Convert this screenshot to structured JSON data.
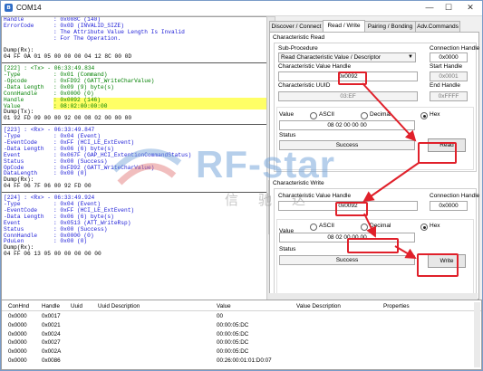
{
  "window": {
    "title": "COM14",
    "icon": "bluetooth-icon",
    "minimize": "—",
    "maximize": "☐",
    "close": "✕"
  },
  "log": {
    "header": [
      {
        "k": "Handle",
        "v": ": 0x008C (140)",
        "c": "c-blue"
      },
      {
        "k": "ErrorCode",
        "v": ": 0x0D (INVALID_SIZE)",
        "c": "c-blue"
      },
      {
        "k": "",
        "v": ": The Attribute Value Length Is Invalid",
        "c": "c-blue"
      },
      {
        "k": "",
        "v": ": For The Operation.",
        "c": "c-blue"
      }
    ],
    "dump0_label": "Dump(Rx):",
    "dump0": "04 FF 0A 01 05 00 00 00 04 12 8C 00 0D",
    "e222": {
      "header": "[222] : <Tx> - 06:33:49.834",
      "fields": [
        {
          "k": "-Type",
          "v": ": 0x01 (Command)"
        },
        {
          "k": "-Opcode",
          "v": ": 0xFD92 (GATT_WriteCharValue)"
        },
        {
          "k": "-Data Length",
          "v": ": 0x09 (9) byte(s)"
        },
        {
          "k": "ConnHandle",
          "v": ": 0x0000 (0)"
        },
        {
          "k": "Handle",
          "v": ": 0x0092 (146)"
        },
        {
          "k": "Value",
          "v": ": 08:02:00:00:00"
        }
      ],
      "dump_label": "Dump(Tx):",
      "dump": "01 92 FD 09 00 00 92 00 08 02 00 00 00"
    },
    "e223": {
      "header": "[223] : <Rx> - 06:33:49.847",
      "fields": [
        {
          "k": "-Type",
          "v": ": 0x04 (Event)"
        },
        {
          "k": "-EventCode",
          "v": ": 0xFF (HCI_LE_ExtEvent)"
        },
        {
          "k": "-Data Length",
          "v": ": 0x06 (6) byte(s)"
        },
        {
          "k": "Event",
          "v": ": 0x067F (GAP_HCI_ExtentionCommandStatus)"
        },
        {
          "k": "Status",
          "v": ": 0x00 (Success)"
        },
        {
          "k": "OpCode",
          "v": ": 0xFD92 (GATT_WriteCharValue)"
        },
        {
          "k": "DataLength",
          "v": ": 0x00 (0)"
        }
      ],
      "dump_label": "Dump(Rx):",
      "dump": "04 FF 06 7F 06 00 92 FD 00"
    },
    "e224": {
      "header": "[224] : <Rx> - 06:33:49.924",
      "fields": [
        {
          "k": "-Type",
          "v": ": 0x04 (Event)"
        },
        {
          "k": "-EventCode",
          "v": ": 0xFF (HCI_LE_ExtEvent)"
        },
        {
          "k": "-Data Length",
          "v": ": 0x06 (6) byte(s)"
        },
        {
          "k": "Event",
          "v": ": 0x0513 (ATT_WriteRsp)"
        },
        {
          "k": "Status",
          "v": ": 0x00 (Success)"
        },
        {
          "k": "ConnHandle",
          "v": ": 0x0000 (0)"
        },
        {
          "k": "PduLen",
          "v": ": 0x00 (0)"
        }
      ],
      "dump_label": "Dump(Rx):",
      "dump": "04 FF 06 13 05 00 00 00 00 00"
    }
  },
  "watermark": {
    "text": "RF-star",
    "cn": "信驰达"
  },
  "tabs": [
    "Discover / Connect",
    "Read / Write",
    "Pairing / Bonding",
    "Adv.Commands"
  ],
  "read": {
    "group_title": "Characteristic Read",
    "sub_label": "Sub-Procedure",
    "sub_value": "Read Characteristic Value / Descriptor",
    "conn_label": "Connection Handle",
    "conn_value": "0x0000",
    "handle_label": "Characteristic Value Handle",
    "handle_value": "0x0092",
    "start_label": "Start Handle",
    "start_value": "0x0001",
    "uuid_label": "Characteristic UUID",
    "uuid_value": "03:EF",
    "end_label": "End Handle",
    "end_value": "0xFFFF",
    "value_label": "Value",
    "radio_ascii": "ASCII",
    "radio_decimal": "Decimal",
    "radio_hex": "Hex",
    "value": "08 02 00 00 00",
    "status_label": "Status",
    "status": "Success",
    "button": "Read"
  },
  "write": {
    "group_title": "Characteristic Write",
    "handle_label": "Characteristic Value Handle",
    "handle_value": "0x0092",
    "conn_label": "Connection Handle",
    "conn_value": "0x0000",
    "value_label": "Value",
    "radio_ascii": "ASCII",
    "radio_decimal": "Decimal",
    "radio_hex": "Hex",
    "value": "08 02 00 00 00",
    "status_label": "Status",
    "status": "Success",
    "button": "Write"
  },
  "table": {
    "columns": [
      "ConHnd",
      "Handle",
      "Uuid",
      "Uuid Description",
      "Value",
      "Value Description",
      "Properties"
    ],
    "rows": [
      [
        "0x0000",
        "0x0017",
        "",
        "",
        "00",
        "",
        ""
      ],
      [
        "0x0000",
        "0x0021",
        "",
        "",
        "00:00:05:DC",
        "",
        ""
      ],
      [
        "0x0000",
        "0x0024",
        "",
        "",
        "00:00:05:DC",
        "",
        ""
      ],
      [
        "0x0000",
        "0x0027",
        "",
        "",
        "00:00:05:DC",
        "",
        ""
      ],
      [
        "0x0000",
        "0x002A",
        "",
        "",
        "00:00:05:DC",
        "",
        ""
      ],
      [
        "0x0000",
        "0x0086",
        "",
        "",
        "00:26:00:01:01:D0:07",
        "",
        ""
      ]
    ]
  },
  "colors": {
    "accent_red": "#e0202a",
    "log_blue": "#1a1ad6",
    "log_green": "#008000"
  }
}
